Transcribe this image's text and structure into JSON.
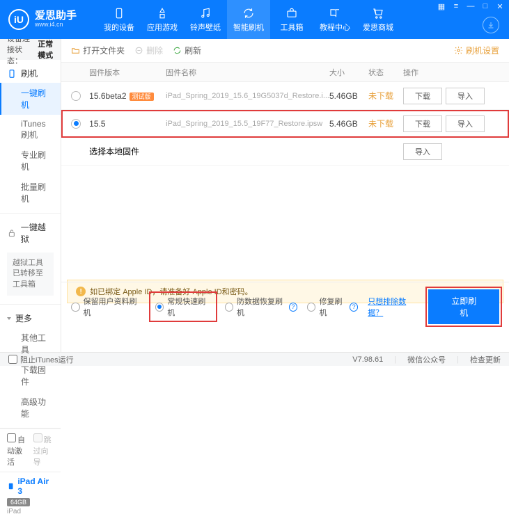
{
  "brand": {
    "name": "爱思助手",
    "url": "www.i4.cn",
    "logo_letter": "iU"
  },
  "nav": [
    {
      "label": "我的设备"
    },
    {
      "label": "应用游戏"
    },
    {
      "label": "铃声壁纸"
    },
    {
      "label": "智能刷机"
    },
    {
      "label": "工具箱"
    },
    {
      "label": "教程中心"
    },
    {
      "label": "爱思商城"
    }
  ],
  "status": {
    "prefix": "设备连接状态：",
    "value": "正常模式"
  },
  "sidebar": {
    "flash": {
      "head": "刷机",
      "items": [
        "一键刷机",
        "iTunes刷机",
        "专业刷机",
        "批量刷机"
      ]
    },
    "jailbreak": {
      "head": "一键越狱",
      "note": "越狱工具已转移至工具箱"
    },
    "more": {
      "head": "更多",
      "items": [
        "其他工具",
        "下载固件",
        "高级功能"
      ]
    },
    "auto_activate": "自动激活",
    "skip_guide": "跳过向导"
  },
  "device": {
    "name": "iPad Air 3",
    "storage": "64GB",
    "model": "iPad"
  },
  "toolbar": {
    "open": "打开文件夹",
    "delete": "删除",
    "refresh": "刷新",
    "settings": "刷机设置"
  },
  "thead": {
    "ver": "固件版本",
    "name": "固件名称",
    "size": "大小",
    "stat": "状态",
    "ops": "操作"
  },
  "rows": [
    {
      "ver": "15.6beta2",
      "beta": "测试版",
      "name": "iPad_Spring_2019_15.6_19G5037d_Restore.i...",
      "size": "5.46GB",
      "stat": "未下载",
      "selected": false
    },
    {
      "ver": "15.5",
      "beta": "",
      "name": "iPad_Spring_2019_15.5_19F77_Restore.ipsw",
      "size": "5.46GB",
      "stat": "未下载",
      "selected": true
    }
  ],
  "local_row": "选择本地固件",
  "btn": {
    "download": "下载",
    "import": "导入"
  },
  "warning": "如已绑定 Apple ID，请准备好 Apple ID和密码。",
  "modes": {
    "keep": "保留用户资料刷机",
    "normal": "常规快速刷机",
    "recover": "防数据恢复刷机",
    "repair": "修复刷机",
    "exclude": "只想排除数据？",
    "flash": "立即刷机"
  },
  "footer": {
    "block": "阻止iTunes运行",
    "version": "V7.98.61",
    "wechat": "微信公众号",
    "update": "检查更新"
  }
}
